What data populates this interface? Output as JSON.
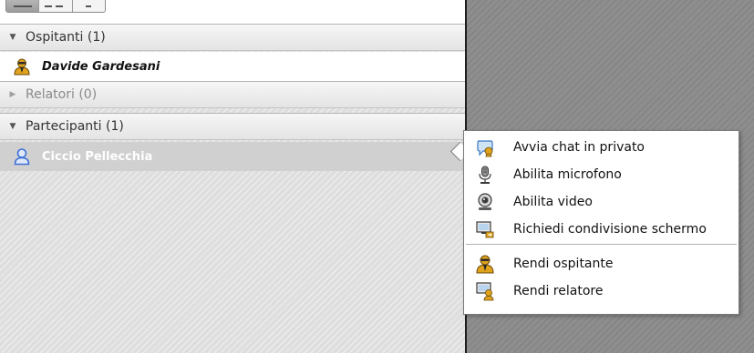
{
  "groups": {
    "hosts": {
      "label": "Ospitanti (1)",
      "expanded": true,
      "members": [
        {
          "name": "Davide Gardesani",
          "icon": "host-user-icon"
        }
      ]
    },
    "presenters": {
      "label": "Relatori (0)",
      "expanded": false,
      "members": []
    },
    "participants": {
      "label": "Partecipanti (1)",
      "expanded": true,
      "members": [
        {
          "name": "Ciccio Pellecchia",
          "icon": "participant-user-icon",
          "selected": true
        }
      ]
    }
  },
  "context_menu": {
    "items": [
      {
        "label": "Avvia chat in privato",
        "icon": "chat-bubble-icon"
      },
      {
        "label": "Abilita microfono",
        "icon": "microphone-icon"
      },
      {
        "label": "Abilita video",
        "icon": "webcam-icon"
      },
      {
        "label": "Richiedi condivisione schermo",
        "icon": "screen-share-icon"
      },
      {
        "label": "Rendi ospitante",
        "icon": "host-user-icon"
      },
      {
        "label": "Rendi relatore",
        "icon": "presenter-icon"
      }
    ]
  },
  "colors": {
    "host_icon": "#e0a31c",
    "participant_icon": "#3d6fd6",
    "selected_row": "#d0d0d0",
    "right_pane": "#8e8e8e"
  }
}
